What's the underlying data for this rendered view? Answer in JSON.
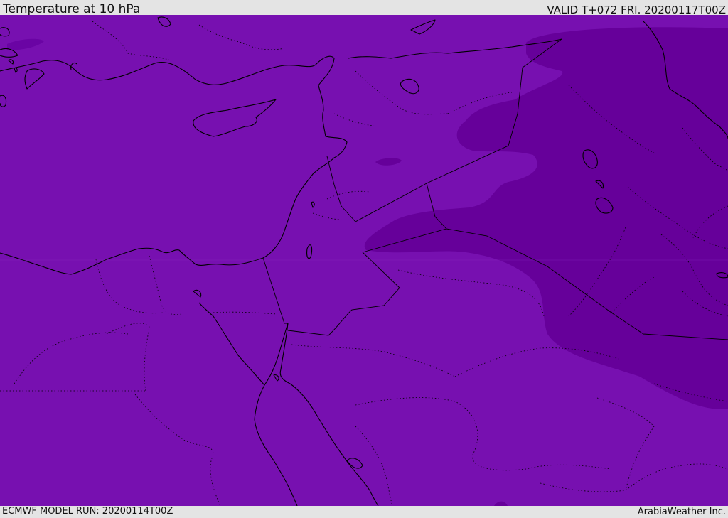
{
  "header": {
    "title": "Temperature at 10 hPa",
    "valid": "VALID T+072 FRI. 20200117T00Z"
  },
  "footer": {
    "model_run": "ECMWF MODEL RUN: 20200114T00Z",
    "credit": "ArabiaWeather Inc."
  },
  "colors": {
    "base_field": "#7710b0",
    "colder_field": "#66009a",
    "coastline": "#000000",
    "bar_background": "#e4e4e4"
  }
}
